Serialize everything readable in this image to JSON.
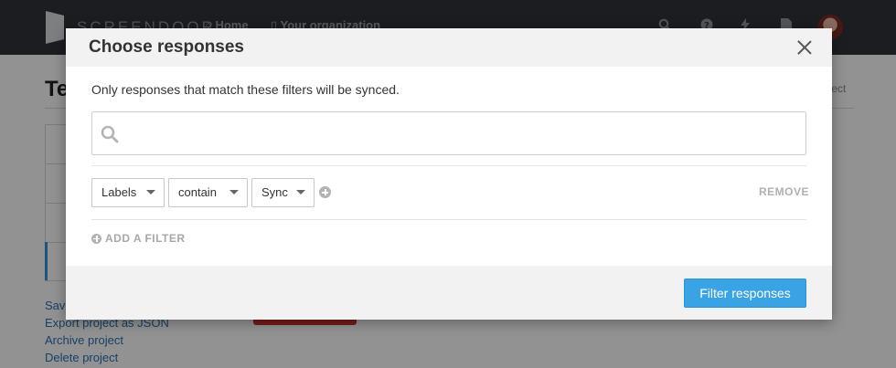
{
  "app": {
    "brand": "SCREENDOOR",
    "nav": {
      "home": "Home",
      "organization": "Your organization"
    },
    "top_icons": [
      "search-icon",
      "help-icon",
      "bolt-icon",
      "document-icon"
    ],
    "page_title": "Te",
    "project_link": "oject",
    "side_links": [
      "Save",
      "Export project as JSON",
      "Archive project",
      "Delete project"
    ]
  },
  "modal": {
    "title": "Choose responses",
    "description": "Only responses that match these filters will be synced.",
    "search": {
      "value": "",
      "placeholder": ""
    },
    "filter": {
      "field": "Labels",
      "operator": "contain",
      "value": "Sync",
      "remove_label": "REMOVE"
    },
    "add_filter_label": "ADD A FILTER",
    "submit_label": "Filter responses"
  },
  "colors": {
    "primary": "#3aa3e3",
    "topbar": "#2f3338",
    "danger": "#c9332e",
    "link": "#2a6fb3"
  }
}
